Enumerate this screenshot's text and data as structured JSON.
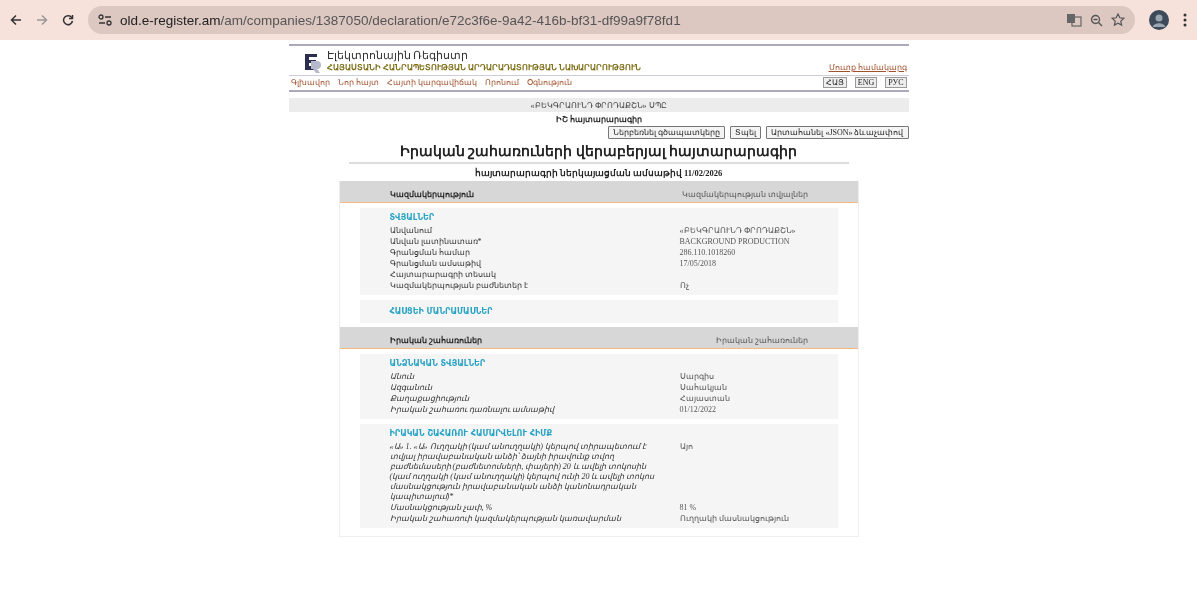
{
  "browser": {
    "url_host": "old.e-register.am",
    "url_path": "/am/companies/1387050/declaration/e72c3f6e-9a42-416b-bf31-df99a9f78fd1"
  },
  "header": {
    "logo_title": "Էլեկտրոնային Ռեգիստր",
    "logo_subtitle": "ՀԱՅԱՍՏԱՆԻ ՀԱՆՐԱՊԵՏՈՒԹՅԱՆ ԱՐԴԱՐԱԴԱՏՈՒԹՅԱՆ ՆԱԽԱՐԱՐՈՒԹՅՈՒՆ",
    "login_link": "Մուտք համակարգ",
    "nav": [
      "Գլխավոր",
      "Նոր հայտ",
      "Հայտի կարգավիճակ",
      "Որոնում",
      "Օգնություն"
    ],
    "languages": [
      "ՀԱՅ",
      "ENG",
      "РУС"
    ]
  },
  "company_name": "«ԲԵԿԳՐԱՈՒՆԴ ՓՐՈԴԱՔՇՆ» ՍՊԸ",
  "declaration_label": "ԻՇ հայտարարագիր",
  "actions": [
    "Ներբեռնել գծապատկերը",
    "Տպել",
    "Արտահանել «JSON» ձևաչափով"
  ],
  "title": "Իրական շահառուների վերաբերյալ հայտարարագիր",
  "submission_date": "հայտարարագրի ներկայացման ամսաթիվ 11/02/2026",
  "sections": [
    {
      "title": "Կազմակերպություն",
      "subtitle": "Կազմակերպության տվյալներ",
      "groups": [
        {
          "heading": "ՏՎՅԱԼՆԵՐ",
          "rows": [
            {
              "label": "Անվանում",
              "value": "«ԲԵԿԳՐԱՈՒՆԴ ՓՐՈԴԱՔՇՆ»"
            },
            {
              "label": "Անվան լատինատառ*",
              "value": "BACKGROUND PRODUCTION"
            },
            {
              "label": "Գրանցման համար",
              "value": "286.110.1018260"
            },
            {
              "label": "Գրանցման ամսաթիվ",
              "value": "17/05/2018"
            },
            {
              "label": "Հայտարարագրի տեսակ"
            },
            {
              "label": "Կազմակերպության բաժնետեր է",
              "value": "Ոչ"
            }
          ]
        },
        {
          "heading": "ՀԱՍՑԵԻ ՄԱՆՐԱՄԱՍՆԵՐ"
        }
      ]
    },
    {
      "title": "Իրական շահառուներ",
      "subtitle": "Իրական շահառուներ",
      "groups": [
        {
          "heading": "ԱՆՁՆԱԿԱՆ ՏՎՅԱԼՆԵՐ",
          "rows": [
            {
              "label": "Անուն",
              "value": "Սարգիս"
            },
            {
              "label": "Ազգանուն",
              "value": "Սահակյան"
            },
            {
              "label": "Քաղաքացիություն",
              "value": "Հայաստան"
            },
            {
              "label": "Իրական շահառու դառնալու ամսաթիվ",
              "value": "01/12/2022"
            }
          ]
        },
        {
          "heading": "ԻՐԱԿԱՆ ՇԱՀԱՌՈՒ ՀԱՄԱՐՎԵԼՈՒ ՀԻՄՔ",
          "rows": [
            {
              "label": "«Ա» 1. «Ա» Ուղղակի (կամ անուղղակի) կերպով տիրապետում է տվյալ իրավաբանական անձի՝ ձայնի իրավունք տվող բաժնեմասերի (բաժնետոմսերի, փայերի) 20 և ավելի տոկոսին (կամ ուղղակի (կամ անուղղակի) կերպով ունի 20 և ավելի տոկոս մասնակցություն իրավաբանական անձի կանոնադրական կապիտալում)*",
              "value": "Այո"
            },
            {
              "label": "Մասնակցության չափ, %",
              "value": "81 %"
            },
            {
              "label": "Իրական շահառուի կազմակերպության կառավարման",
              "value": "Ուղղակի մասնակցություն"
            }
          ]
        }
      ]
    }
  ]
}
